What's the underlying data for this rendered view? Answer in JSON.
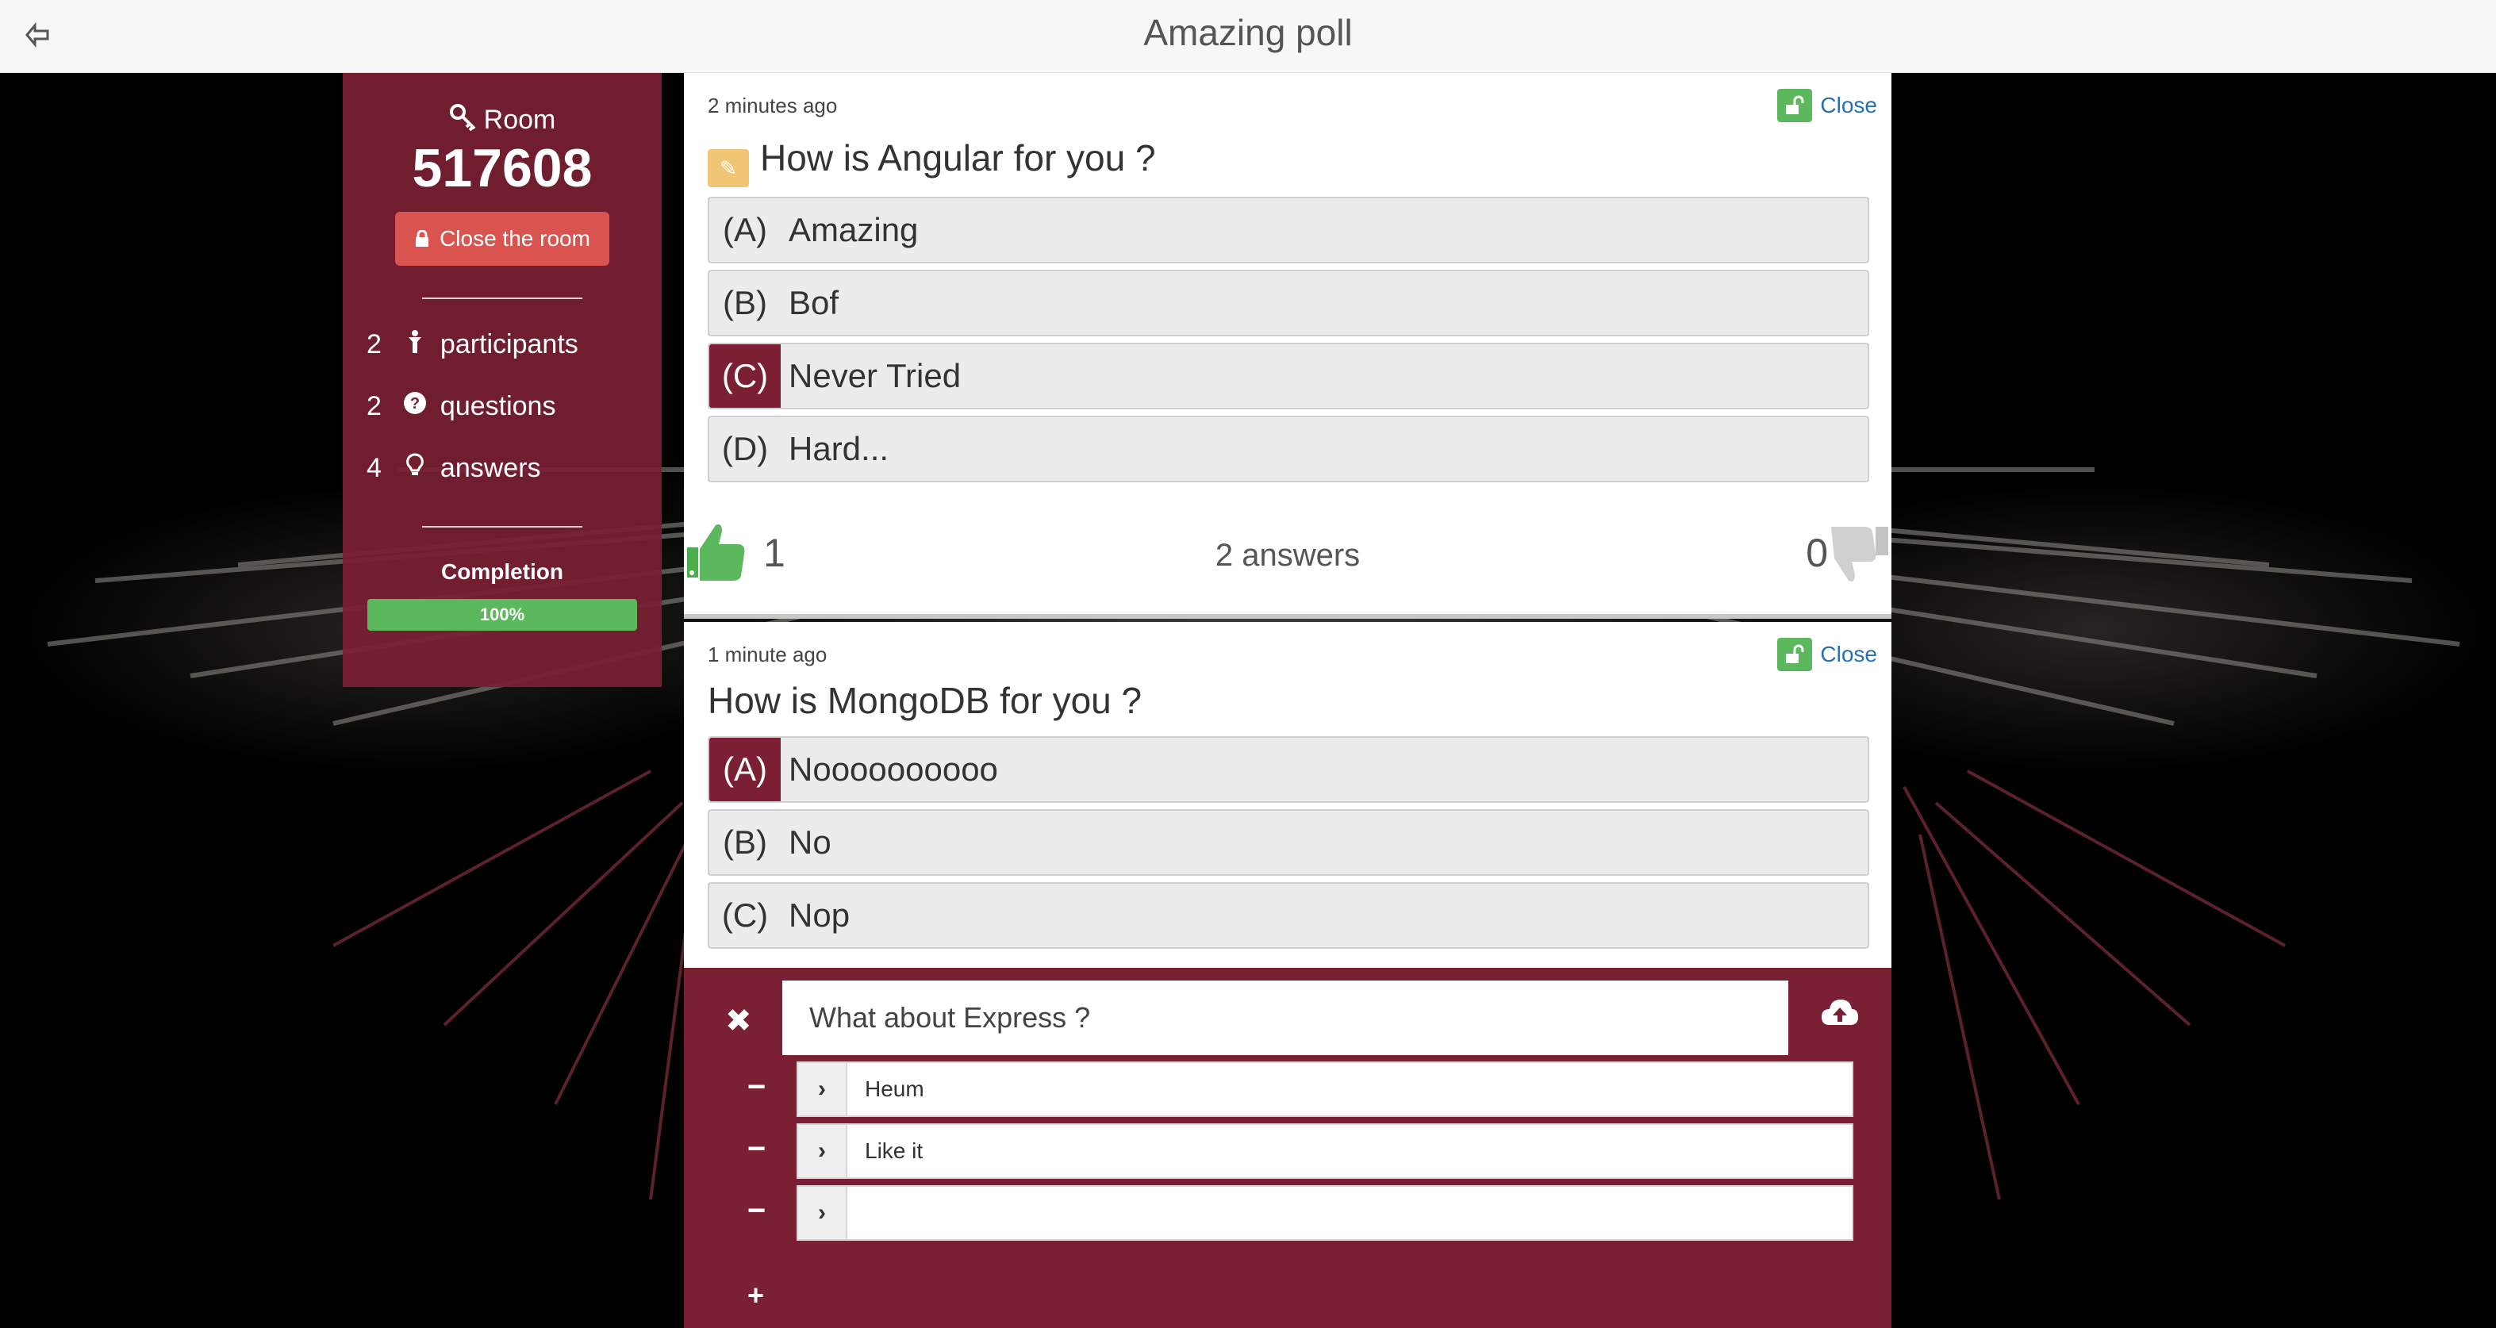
{
  "header": {
    "title": "Amazing poll",
    "back_icon": "sign-out-icon"
  },
  "sidebar": {
    "room_label": "Room",
    "room_number": "517608",
    "close_room_label": "Close the room",
    "stats": [
      {
        "count": "2",
        "label": "participants",
        "icon": "user-icon"
      },
      {
        "count": "2",
        "label": "questions",
        "icon": "question-circle-icon"
      },
      {
        "count": "4",
        "label": "answers",
        "icon": "lightbulb-icon"
      }
    ],
    "completion_label": "Completion",
    "completion_value": "100%",
    "completion_fraction": 1.0,
    "accent_color": "#7a1f34",
    "progress_color": "#5cb85c"
  },
  "questions": [
    {
      "time": "2 minutes ago",
      "close_label": "Close",
      "title": "How is Angular for you ?",
      "options": [
        {
          "letter": "(A)",
          "label": "Amazing",
          "selected": false
        },
        {
          "letter": "(B)",
          "label": "Bof",
          "selected": false
        },
        {
          "letter": "(C)",
          "label": "Never Tried",
          "selected": true
        },
        {
          "letter": "(D)",
          "label": "Hard...",
          "selected": false
        }
      ],
      "upvotes": "1",
      "answers_count": "2 answers",
      "downvotes": "0"
    },
    {
      "time": "1 minute ago",
      "close_label": "Close",
      "title": "How is MongoDB for you ?",
      "options": [
        {
          "letter": "(A)",
          "label": "Noooooooooo",
          "selected": true
        },
        {
          "letter": "(B)",
          "label": "No",
          "selected": false
        },
        {
          "letter": "(C)",
          "label": "Nop",
          "selected": false
        }
      ]
    }
  ],
  "new_question": {
    "question_value": "What about Express ?",
    "answers": [
      "Heum",
      "Like it",
      ""
    ]
  }
}
